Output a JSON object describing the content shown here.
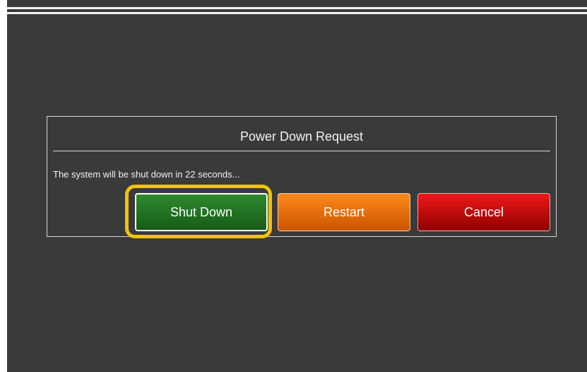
{
  "dialog": {
    "title": "Power Down Request",
    "message": "The system will be shut down in 22 seconds..."
  },
  "buttons": {
    "shutdown": "Shut Down",
    "restart": "Restart",
    "cancel": "Cancel"
  },
  "colors": {
    "background": "#3a3a3a",
    "shutdown": "#1f6f1f",
    "restart": "#e86a0a",
    "cancel": "#c40000",
    "focus": "#f0c20a"
  }
}
